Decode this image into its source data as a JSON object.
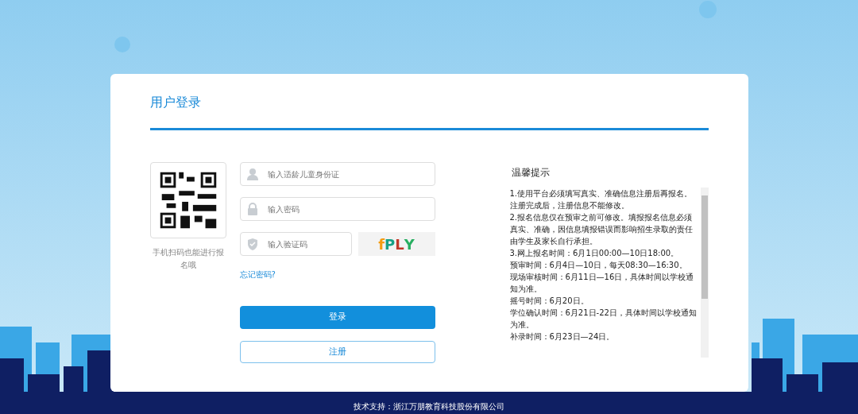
{
  "login_card": {
    "title": "用户登录",
    "qr_caption": "手机扫码也能进行报名哦",
    "fields": [
      {
        "kind": "user",
        "placeholder": "输入适龄儿童身份证"
      },
      {
        "kind": "lock",
        "placeholder": "输入密码"
      },
      {
        "kind": "shield",
        "placeholder": "输入验证码"
      }
    ],
    "captcha_text": "fPLY",
    "forgot_link": "忘记密码?",
    "login_button": "登录",
    "register_button": "注册"
  },
  "notice": {
    "title": "温馨提示",
    "lines": [
      "1.使用平台必须填写真实、准确信息注册后再报名。注册完成后，注册信息不能修改。",
      "2.报名信息仅在预审之前可修改。填报报名信息必须真实、准确，因信息填报错误而影响招生录取的责任由学生及家长自行承担。",
      "3.网上报名时间：6月1日00:00—10日18:00。",
      "预审时间：6月4日—10日，每天08:30—16:30。",
      "现场审核时间：6月11日—16日，具体时间以学校通知为准。",
      "摇号时间：6月20日。",
      "学位确认时间：6月21日-22日，具体时间以学校通知为准。",
      "补录时间：6月23日—24日。"
    ]
  },
  "footer": "技术支持：浙江万朋教育科技股份有限公司"
}
